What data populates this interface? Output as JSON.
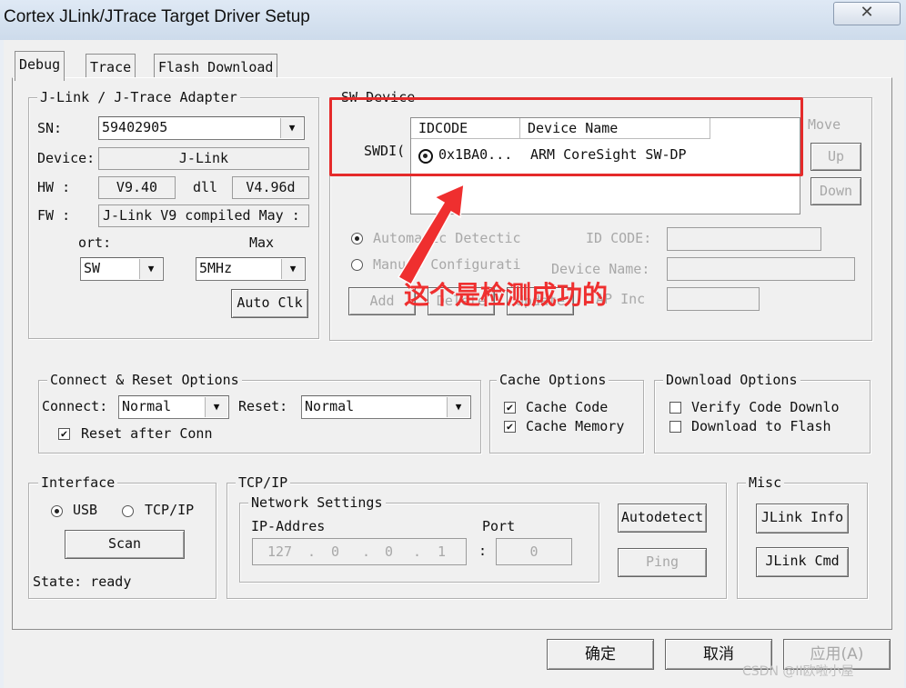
{
  "window": {
    "title": "Cortex JLink/JTrace Target Driver Setup",
    "close_glyph": "✕"
  },
  "tabs": [
    "Debug",
    "Trace",
    "Flash Download"
  ],
  "adapter": {
    "group": "J-Link / J-Trace Adapter",
    "sn_label": "SN:",
    "sn_value": "59402905",
    "device_label": "Device:",
    "device_value": "J-Link",
    "hw_label": "HW :",
    "hw_value": "V9.40",
    "dll_label": "dll",
    "dll_value": "V4.96d",
    "fw_label": "FW :",
    "fw_value": "J-Link V9 compiled May :",
    "port_label": "ort:",
    "port_value": "SW",
    "max_label": "Max",
    "max_value": "5MHz",
    "autoclk": "Auto Clk"
  },
  "swdevice": {
    "group": "SW Device",
    "move": "Move",
    "up": "Up",
    "down": "Down",
    "col_idcode": "IDCODE",
    "col_devname": "Device Name",
    "row_prefix": "SWDI(",
    "row_idcode": "0x1BA0...",
    "row_devname": "ARM CoreSight SW-DP",
    "auto_detect": "Automatic Detectic",
    "manual_config": "Manual Configurati",
    "id_code_label": "ID CODE:",
    "device_name_label": "Device Name:",
    "ap_label": "AP Inc",
    "add": "Add",
    "delete": "Delete",
    "update": "Update"
  },
  "annotation": "这个是检测成功的",
  "connect": {
    "group": "Connect & Reset Options",
    "connect_label": "Connect:",
    "connect_value": "Normal",
    "reset_label": "Reset:",
    "reset_value": "Normal",
    "reset_after": "Reset after Conn"
  },
  "cache": {
    "group": "Cache Options",
    "code": "Cache Code",
    "memory": "Cache Memory"
  },
  "download": {
    "group": "Download Options",
    "verify": "Verify Code Downlo",
    "to_flash": "Download to Flash"
  },
  "interface": {
    "group": "Interface",
    "usb": "USB",
    "tcpip": "TCP/IP",
    "scan": "Scan",
    "state": "State: ready"
  },
  "tcpip": {
    "group": "TCP/IP",
    "network": "Network Settings",
    "ip_label": "IP-Addres",
    "port_label": "Port",
    "ip": [
      "127",
      "0",
      "0",
      "1"
    ],
    "port": "0",
    "autodetect": "Autodetect",
    "ping": "Ping"
  },
  "misc": {
    "group": "Misc",
    "jlink_info": "JLink Info",
    "jlink_cmd": "JLink Cmd"
  },
  "buttons": {
    "ok": "确定",
    "cancel": "取消",
    "apply": "应用(A)"
  },
  "watermark": "CSDN @II欧啦小屋"
}
